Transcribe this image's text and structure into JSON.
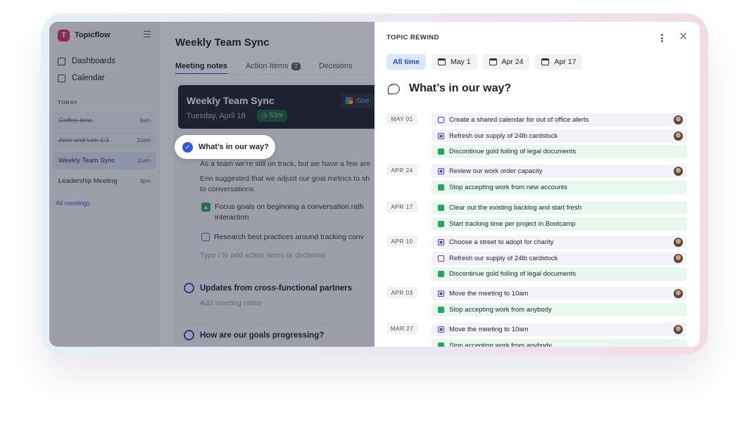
{
  "app": {
    "name": "Topicflow"
  },
  "sidebar": {
    "nav": [
      {
        "label": "Dashboards",
        "icon": "home-icon"
      },
      {
        "label": "Calendar",
        "icon": "calendar-icon"
      }
    ],
    "today_label": "TODAY",
    "meetings": [
      {
        "name": "Coffee time",
        "time": "9am",
        "status": "done"
      },
      {
        "name": "Jess and Lee 1:1",
        "time": "10am",
        "status": "done"
      },
      {
        "name": "Weekly Team Sync",
        "time": "11am",
        "status": "active"
      },
      {
        "name": "Leadership Meeting",
        "time": "3pm",
        "status": "upcoming"
      }
    ],
    "all_meetings": "All meetings"
  },
  "main": {
    "title": "Weekly Team Sync",
    "tabs": [
      {
        "label": "Meeting notes",
        "active": true
      },
      {
        "label": "Action Items",
        "badge": "7"
      },
      {
        "label": "Decisions"
      }
    ],
    "header": {
      "title": "Weekly Team Sync",
      "date": "Tuesday, April 18",
      "duration": "53m",
      "google_label": "Goo"
    },
    "topic1": {
      "title": "What’s in our way?",
      "line1": "As a team we’re still on track, but we have a few are",
      "line2": "Erin suggested that we adjust our goal metrics to sh",
      "line3": "to conversations.",
      "decision": "Focus goals on beginning a conversation rath",
      "decision2": "interaction",
      "action": "Research best practices around tracking conv",
      "hint": "Type / to add action items or decisions"
    },
    "topic2": {
      "title": "Updates from cross-functional partners",
      "hint": "Add meeting notes"
    },
    "topic3": {
      "title": "How are our goals progressing?"
    }
  },
  "panel": {
    "title": "TOPIC REWIND",
    "filters": [
      {
        "label": "All time",
        "active": true
      },
      {
        "label": "May 1"
      },
      {
        "label": "Apr 24"
      },
      {
        "label": "Apr 17"
      }
    ],
    "question": "What’s in our way?",
    "groups": [
      {
        "date": "MAY 01",
        "items": [
          {
            "text": "Create a shared calendar for out of office alerts",
            "type": "action",
            "checked": false,
            "avatar": true
          },
          {
            "text": "Refresh our supply of 24lb cardstock",
            "type": "action",
            "checked": true,
            "avatar": true
          },
          {
            "text": "Discontinue gold foiling of legal documents",
            "type": "decision",
            "avatar": false
          }
        ]
      },
      {
        "date": "APR 24",
        "items": [
          {
            "text": "Review our work order capacity",
            "type": "action",
            "checked": true,
            "avatar": true
          },
          {
            "text": "Stop accepting work from new accounts",
            "type": "decision",
            "avatar": false
          }
        ]
      },
      {
        "date": "APR 17",
        "items": [
          {
            "text": "Clear out the existing backlog and start fresh",
            "type": "decision",
            "avatar": false
          },
          {
            "text": "Start tracking time per project in Bootcamp",
            "type": "decision",
            "avatar": false
          }
        ]
      },
      {
        "date": "APR 10",
        "items": [
          {
            "text": "Choose a street to adopt for charity",
            "type": "action",
            "checked": true,
            "avatar": true
          },
          {
            "text": "Refresh our supply of 24lb cardstock",
            "type": "action",
            "checked": false,
            "avatar": true
          },
          {
            "text": "Discontinue gold foiling of legal documents",
            "type": "decision",
            "avatar": false
          }
        ]
      },
      {
        "date": "APR 03",
        "items": [
          {
            "text": "Move the meeting to 10am",
            "type": "action",
            "checked": true,
            "avatar": true
          },
          {
            "text": "Stop accepting work from anybody",
            "type": "decision",
            "avatar": false
          }
        ]
      },
      {
        "date": "MAR 27",
        "items": [
          {
            "text": "Move the meeting to 10am",
            "type": "action",
            "checked": true,
            "avatar": true
          },
          {
            "text": "Stop accepting work from anybody",
            "type": "decision",
            "avatar": false
          }
        ]
      }
    ]
  }
}
